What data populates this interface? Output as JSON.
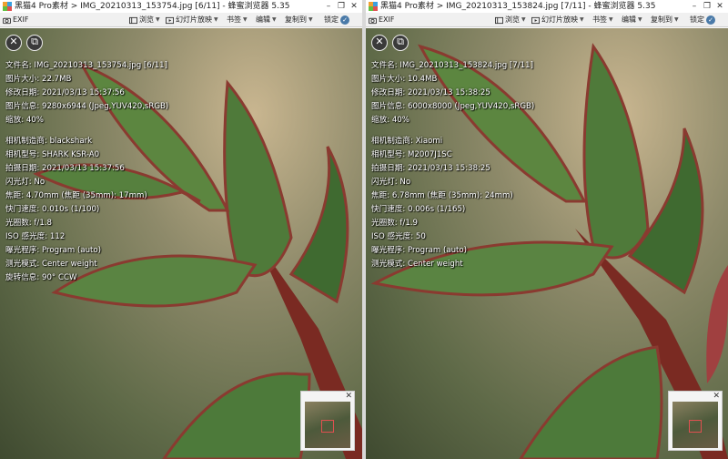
{
  "app": {
    "close_glyph": "✕",
    "open_glyph": "⧉",
    "window_buttons": [
      "–",
      "❐",
      "✕"
    ],
    "toolbar": {
      "exif": "EXIF",
      "browse": "浏览",
      "slideshow": "幻灯片放映",
      "bookmark": "书签",
      "edit": "编辑",
      "copy_to": "复制到",
      "lock": "锁定"
    }
  },
  "panes": [
    {
      "title": "黑猫4 Pro素材 > IMG_20210313_153754.jpg [6/11] - 蜂蜜浏览器 5.35",
      "info_group1": [
        "文件名: IMG_20210313_153754.jpg [6/11]",
        "图片大小: 22.7MB",
        "修改日期: 2021/03/13 15:37:56",
        "图片信息: 9280x6944 (Jpeg,YUV420,sRGB)",
        "缩放: 40%"
      ],
      "info_group2": [
        "相机制造商: blackshark",
        "相机型号: SHARK KSR-A0",
        "拍摄日期: 2021/03/13 15:37:56",
        "闪光灯: No",
        "焦距: 4.70mm (焦距 (35mm): 17mm)",
        "快门速度: 0.010s (1/100)",
        "光圈数: f/1.8",
        "ISO 感光度: 112",
        "曝光程序: Program (auto)",
        "测光模式: Center weight",
        "旋转信息: 90° CCW"
      ]
    },
    {
      "title": "黑猫4 Pro素材 > IMG_20210313_153824.jpg [7/11] - 蜂蜜浏览器 5.35",
      "info_group1": [
        "文件名: IMG_20210313_153824.jpg [7/11]",
        "图片大小: 10.4MB",
        "修改日期: 2021/03/13 15:38:25",
        "图片信息: 6000x8000 (Jpeg,YUV420,sRGB)",
        "缩放: 40%"
      ],
      "info_group2": [
        "相机制造商: Xiaomi",
        "相机型号: M2007J1SC",
        "拍摄日期: 2021/03/13 15:38:25",
        "闪光灯: No",
        "焦距: 6.78mm (焦距 (35mm): 24mm)",
        "快门速度: 0.006s (1/165)",
        "光圈数: f/1.9",
        "ISO 感光度: 50",
        "曝光程序: Program (auto)",
        "测光模式: Center weight"
      ]
    }
  ],
  "thumb_close": "✕"
}
